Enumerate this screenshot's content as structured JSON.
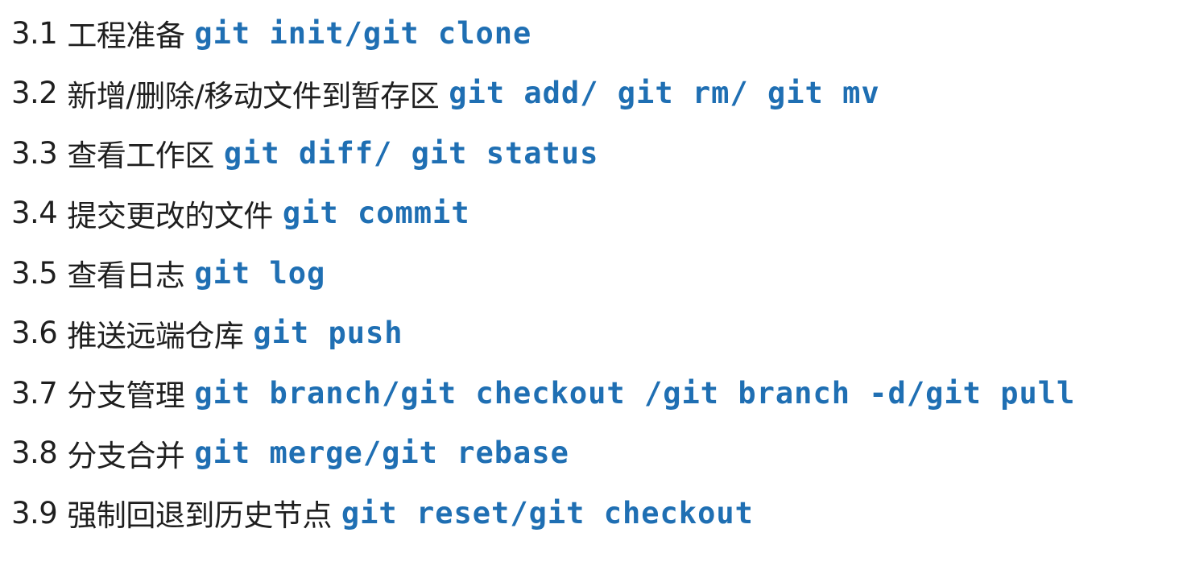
{
  "items": [
    {
      "num": "3.1",
      "label": "工程准备",
      "command": "git init/git clone"
    },
    {
      "num": "3.2",
      "label": "新增/删除/移动文件到暂存区",
      "command": "git add/ git rm/ git mv"
    },
    {
      "num": "3.3",
      "label": "查看工作区",
      "command": "git diff/ git status"
    },
    {
      "num": "3.4",
      "label": "提交更改的文件",
      "command": "git commit"
    },
    {
      "num": "3.5",
      "label": "查看日志",
      "command": "git log"
    },
    {
      "num": "3.6",
      "label": "推送远端仓库",
      "command": "git push"
    },
    {
      "num": "3.7",
      "label": "分支管理",
      "command": "git branch/git checkout /git branch -d/git pull"
    },
    {
      "num": "3.8",
      "label": "分支合并",
      "command": "git merge/git rebase"
    },
    {
      "num": "3.9",
      "label": "强制回退到历史节点",
      "command": "git reset/git checkout"
    }
  ],
  "colors": {
    "text": "#1f1f1f",
    "command": "#1f6fb3",
    "background": "#ffffff"
  }
}
